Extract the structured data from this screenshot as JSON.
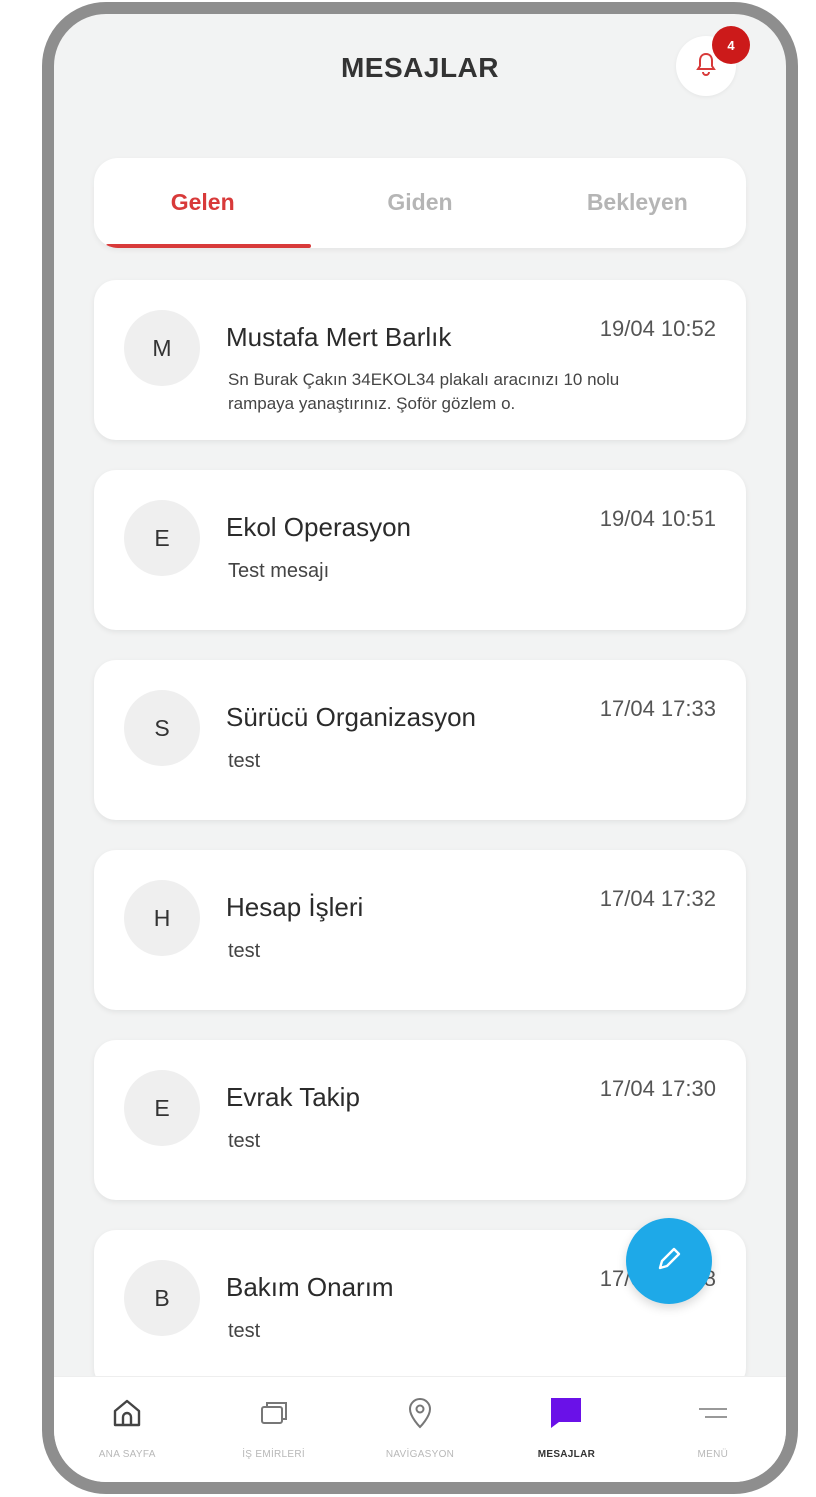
{
  "header": {
    "title": "MESAJLAR",
    "notification_count": "4"
  },
  "tabs": [
    {
      "label": "Gelen",
      "active": true
    },
    {
      "label": "Giden",
      "active": false
    },
    {
      "label": "Bekleyen",
      "active": false
    }
  ],
  "messages": [
    {
      "initial": "M",
      "sender": "Mustafa Mert Barlık",
      "time": "19/04 10:52",
      "preview": "Sn Burak Çakın 34EKOL34 plakalı aracınızı 10 nolu rampaya yanaştırınız. Şoför gözlem o."
    },
    {
      "initial": "E",
      "sender": "Ekol Operasyon",
      "time": "19/04 10:51",
      "preview": "Test mesajı"
    },
    {
      "initial": "S",
      "sender": "Sürücü Organizasyon",
      "time": "17/04 17:33",
      "preview": "test"
    },
    {
      "initial": "H",
      "sender": "Hesap İşleri",
      "time": "17/04 17:32",
      "preview": "test"
    },
    {
      "initial": "E",
      "sender": "Evrak Takip",
      "time": "17/04 17:30",
      "preview": "test"
    },
    {
      "initial": "B",
      "sender": "Bakım Onarım",
      "time": "17/04 17:28",
      "preview": "test"
    }
  ],
  "bottom_nav": [
    {
      "label": "ANA SAYFA",
      "icon": "home-icon",
      "active": false
    },
    {
      "label": "İŞ EMİRLERİ",
      "icon": "stack-icon",
      "active": false
    },
    {
      "label": "NAVİGASYON",
      "icon": "location-pin-icon",
      "active": false
    },
    {
      "label": "MESAJLAR",
      "icon": "chat-bubble-icon",
      "active": true
    },
    {
      "label": "MENÜ",
      "icon": "menu-icon",
      "active": false
    }
  ],
  "colors": {
    "accent": "#d83a3a",
    "badge": "#cc1a1a",
    "fab": "#1ea9e8",
    "active_nav": "#6a11e8"
  }
}
